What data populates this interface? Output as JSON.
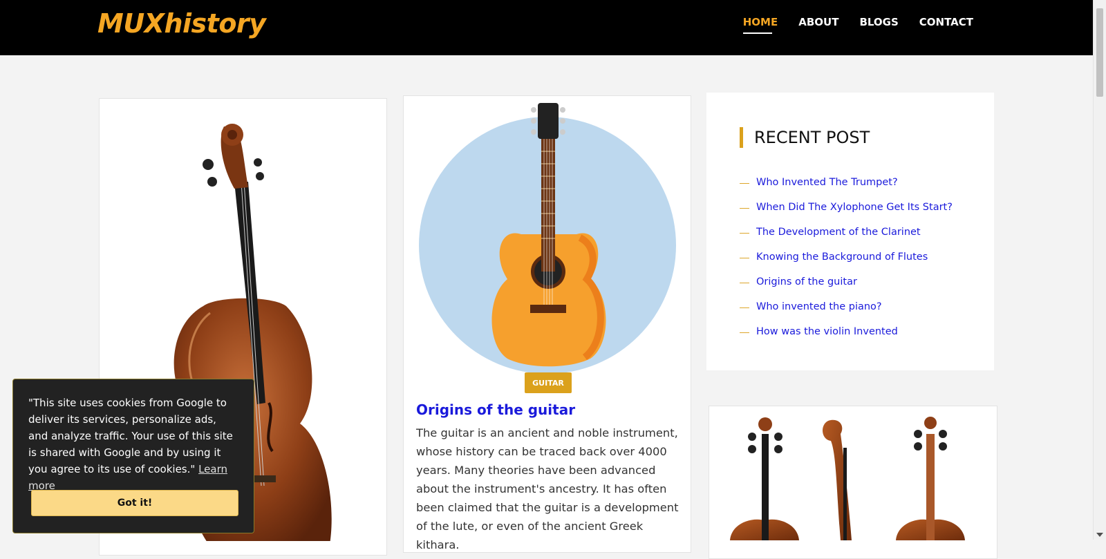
{
  "site": {
    "logo": "MUXhistory"
  },
  "nav": {
    "items": [
      {
        "label": "HOME",
        "active": true
      },
      {
        "label": "ABOUT",
        "active": false
      },
      {
        "label": "BLOGS",
        "active": false
      },
      {
        "label": "CONTACT",
        "active": false
      }
    ]
  },
  "featured_post": {
    "category": "GUITAR",
    "title": "Origins of the guitar",
    "excerpt": "The guitar is an ancient and noble instrument, whose history can be traced back over 4000 years. Many theories have been advanced about the instrument's ancestry. It has often been claimed that the guitar is a development of the lute, or even of the ancient Greek kithara."
  },
  "recent_posts": {
    "heading": "RECENT POST",
    "items": [
      "Who Invented The Trumpet?",
      "When Did The Xylophone Get Its Start?",
      "The Development of the Clarinet",
      "Knowing the Background of Flutes",
      "Origins of the guitar",
      "Who invented the piano?",
      "How was the violin Invented"
    ]
  },
  "cookie_banner": {
    "text": "\"This site uses cookies from Google to deliver its services, personalize ads, and analyze traffic. Your use of this site is shared with Google and by using it you agree to its use of cookies.\"",
    "learn_more": "Learn more",
    "button": "Got it!"
  },
  "colors": {
    "accent": "#dba11c",
    "logo": "#f5a623",
    "link": "#1a1adb",
    "header_bg": "#000000",
    "page_bg": "#f3f3f3"
  }
}
